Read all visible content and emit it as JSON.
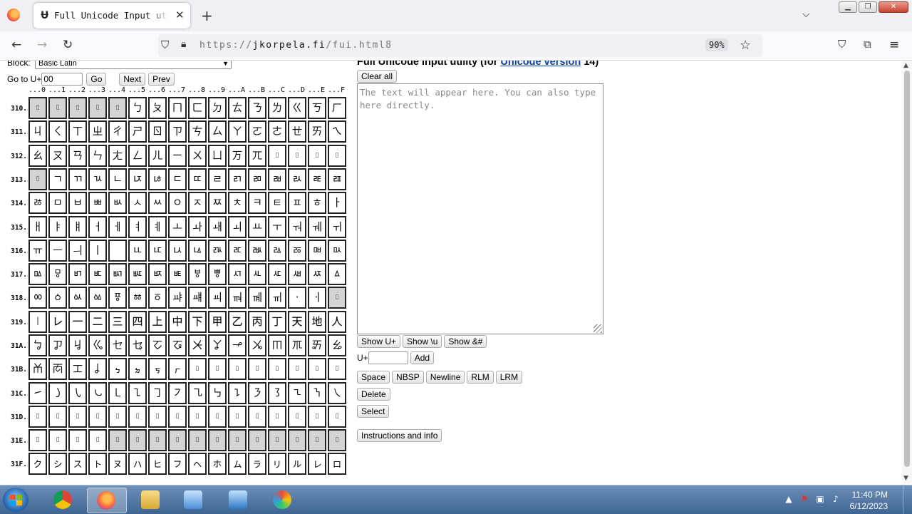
{
  "browser": {
    "tab_icon": "Ʉ",
    "tab_title": "Full Unicode Input utility",
    "url_prefix": "https://",
    "url_host": "jkorpela.fi",
    "url_path": "/fui.html8",
    "zoom": "90%"
  },
  "page": {
    "block_label": "Block:",
    "block_value": "Basic Latin",
    "goto_label": "Go to U+",
    "goto_value": "00",
    "go_button": "Go",
    "next_button": "Next",
    "prev_button": "Prev",
    "title_prefix": "Full Unicode Input utility (for ",
    "title_link": "Unicode version",
    "title_suffix": " 14)",
    "clear_all": "Clear all",
    "textarea_placeholder": "The text will appear here. You can also type here directly.",
    "show_uplus": "Show U+",
    "show_u": "Show \\u",
    "show_amp": "Show &#",
    "uplus_label": "U+",
    "add_button": "Add",
    "space_button": "Space",
    "nbsp_button": "NBSP",
    "newline_button": "Newline",
    "rlm_button": "RLM",
    "lrm_button": "LRM",
    "delete_button": "Delete",
    "select_button": "Select",
    "instructions_button": "Instructions and info"
  },
  "grid": {
    "column_headers": [
      "...0",
      "...1",
      "...2",
      "...3",
      "...4",
      "...5",
      "...6",
      "...7",
      "...8",
      "...9",
      "...A",
      "...B",
      "...C",
      "...D",
      "...E",
      "...F"
    ],
    "rows": [
      {
        "label": "310.",
        "cells": [
          "",
          "",
          "",
          "",
          "",
          "ㄅ",
          "ㄆ",
          "ㄇ",
          "ㄈ",
          "ㄉ",
          "ㄊ",
          "ㄋ",
          "ㄌ",
          "ㄍ",
          "ㄎ",
          "ㄏ"
        ],
        "na": [
          0,
          1,
          2,
          3,
          4
        ],
        "box": [
          0,
          1,
          2,
          3,
          4
        ]
      },
      {
        "label": "311.",
        "cells": [
          "ㄐ",
          "ㄑ",
          "ㄒ",
          "ㄓ",
          "ㄔ",
          "ㄕ",
          "ㄖ",
          "ㄗ",
          "ㄘ",
          "ㄙ",
          "ㄚ",
          "ㄛ",
          "ㄜ",
          "ㄝ",
          "ㄞ",
          "ㄟ"
        ],
        "na": [],
        "box": []
      },
      {
        "label": "312.",
        "cells": [
          "ㄠ",
          "ㄡ",
          "ㄢ",
          "ㄣ",
          "ㄤ",
          "ㄥ",
          "ㄦ",
          "ㄧ",
          "ㄨ",
          "ㄩ",
          "ㄪ",
          "ㄫ",
          "",
          "",
          "",
          ""
        ],
        "na": [],
        "box": [
          12,
          13,
          14,
          15
        ]
      },
      {
        "label": "313.",
        "cells": [
          "",
          "ㄱ",
          "ㄲ",
          "ㄳ",
          "ㄴ",
          "ㄵ",
          "ㄶ",
          "ㄷ",
          "ㄸ",
          "ㄹ",
          "ㄺ",
          "ㄻ",
          "ㄼ",
          "ㄽ",
          "ㄾ",
          "ㄿ"
        ],
        "na": [
          0
        ],
        "box": [
          0
        ]
      },
      {
        "label": "314.",
        "cells": [
          "ㅀ",
          "ㅁ",
          "ㅂ",
          "ㅃ",
          "ㅄ",
          "ㅅ",
          "ㅆ",
          "ㅇ",
          "ㅈ",
          "ㅉ",
          "ㅊ",
          "ㅋ",
          "ㅌ",
          "ㅍ",
          "ㅎ",
          "ㅏ"
        ],
        "na": [],
        "box": []
      },
      {
        "label": "315.",
        "cells": [
          "ㅐ",
          "ㅑ",
          "ㅒ",
          "ㅓ",
          "ㅔ",
          "ㅕ",
          "ㅖ",
          "ㅗ",
          "ㅘ",
          "ㅙ",
          "ㅚ",
          "ㅛ",
          "ㅜ",
          "ㅝ",
          "ㅞ",
          "ㅟ"
        ],
        "na": [],
        "box": []
      },
      {
        "label": "316.",
        "cells": [
          "ㅠ",
          "ㅡ",
          "ㅢ",
          "ㅣ",
          "",
          "ㅥ",
          "ㅦ",
          "ㅧ",
          "ㅨ",
          "ㅩ",
          "ㅪ",
          "ㅫ",
          "ㅬ",
          "ㅭ",
          "ㅮ",
          "ㅯ"
        ],
        "na": [],
        "box": []
      },
      {
        "label": "317.",
        "cells": [
          "ㅰ",
          "ㅱ",
          "ㅲ",
          "ㅳ",
          "ㅴ",
          "ㅵ",
          "ㅶ",
          "ㅷ",
          "ㅸ",
          "ㅹ",
          "ㅺ",
          "ㅻ",
          "ㅼ",
          "ㅽ",
          "ㅾ",
          "ㅿ"
        ],
        "na": [],
        "box": []
      },
      {
        "label": "318.",
        "cells": [
          "ㆀ",
          "ㆁ",
          "ㆂ",
          "ㆃ",
          "ㆄ",
          "ㆅ",
          "ㆆ",
          "ㆇ",
          "ㆈ",
          "ㆉ",
          "ㆊ",
          "ㆋ",
          "ㆌ",
          "ㆍ",
          "ㆎ",
          ""
        ],
        "na": [
          15
        ],
        "box": [
          15
        ]
      },
      {
        "label": "319.",
        "cells": [
          "㆐",
          "㆑",
          "㆒",
          "㆓",
          "㆔",
          "㆕",
          "㆖",
          "㆗",
          "㆘",
          "㆙",
          "㆚",
          "㆛",
          "㆜",
          "㆝",
          "㆞",
          "㆟"
        ],
        "na": [],
        "box": []
      },
      {
        "label": "31A.",
        "cells": [
          "ㆠ",
          "ㆡ",
          "ㆢ",
          "ㆣ",
          "ㆤ",
          "ㆥ",
          "ㆦ",
          "ㆧ",
          "ㆨ",
          "ㆩ",
          "ㆪ",
          "ㆫ",
          "ㆬ",
          "ㆭ",
          "ㆮ",
          "ㆯ"
        ],
        "na": [],
        "box": []
      },
      {
        "label": "31B.",
        "cells": [
          "ㆰ",
          "ㆱ",
          "ㆲ",
          "ㆳ",
          "ㆴ",
          "ㆵ",
          "ㆶ",
          "ㆷ",
          "",
          "",
          "",
          "",
          "",
          "",
          "",
          ""
        ],
        "na": [],
        "box": [
          8,
          9,
          10,
          11,
          12,
          13,
          14,
          15
        ]
      },
      {
        "label": "31C.",
        "cells": [
          "㇀",
          "㇁",
          "㇂",
          "㇃",
          "㇄",
          "㇅",
          "㇆",
          "㇇",
          "㇈",
          "㇉",
          "㇊",
          "㇋",
          "㇌",
          "㇍",
          "㇎",
          "㇏"
        ],
        "na": [],
        "box": []
      },
      {
        "label": "31D.",
        "cells": [
          "",
          "",
          "",
          "",
          "",
          "",
          "",
          "",
          "",
          "",
          "",
          "",
          "",
          "",
          "",
          ""
        ],
        "na": [],
        "box": [
          0,
          1,
          2,
          3,
          4,
          5,
          6,
          7,
          8,
          9,
          10,
          11,
          12,
          13,
          14,
          15
        ]
      },
      {
        "label": "31E.",
        "cells": [
          "",
          "",
          "",
          "",
          "",
          "",
          "",
          "",
          "",
          "",
          "",
          "",
          "",
          "",
          "",
          ""
        ],
        "na": [
          4,
          5,
          6,
          7,
          8,
          9,
          10,
          11,
          12,
          13,
          14,
          15
        ],
        "box": [
          0,
          1,
          2,
          3,
          4,
          5,
          6,
          7,
          8,
          9,
          10,
          11,
          12,
          13,
          14,
          15
        ]
      },
      {
        "label": "31F.",
        "cells": [
          "ㇰ",
          "ㇱ",
          "ㇲ",
          "ㇳ",
          "ㇴ",
          "ㇵ",
          "ㇶ",
          "ㇷ",
          "ㇸ",
          "ㇹ",
          "ㇺ",
          "ㇻ",
          "ㇼ",
          "ㇽ",
          "ㇾ",
          "ㇿ"
        ],
        "na": [],
        "box": []
      }
    ]
  },
  "taskbar": {
    "time": "11:40 PM",
    "date": "6/12/2023"
  },
  "colors": {
    "link": "#0a3ea8",
    "unassigned_cell": "#d4d4d4",
    "taskbar": "#3e6592"
  },
  "icons": [
    "firefox-icon",
    "back-arrow-icon",
    "forward-arrow-icon",
    "reload-icon",
    "shield-icon",
    "lock-icon",
    "star-icon",
    "pocket-icon",
    "extensions-icon",
    "menu-icon",
    "windows-start-icon",
    "chrome-icon",
    "folder-icon"
  ]
}
